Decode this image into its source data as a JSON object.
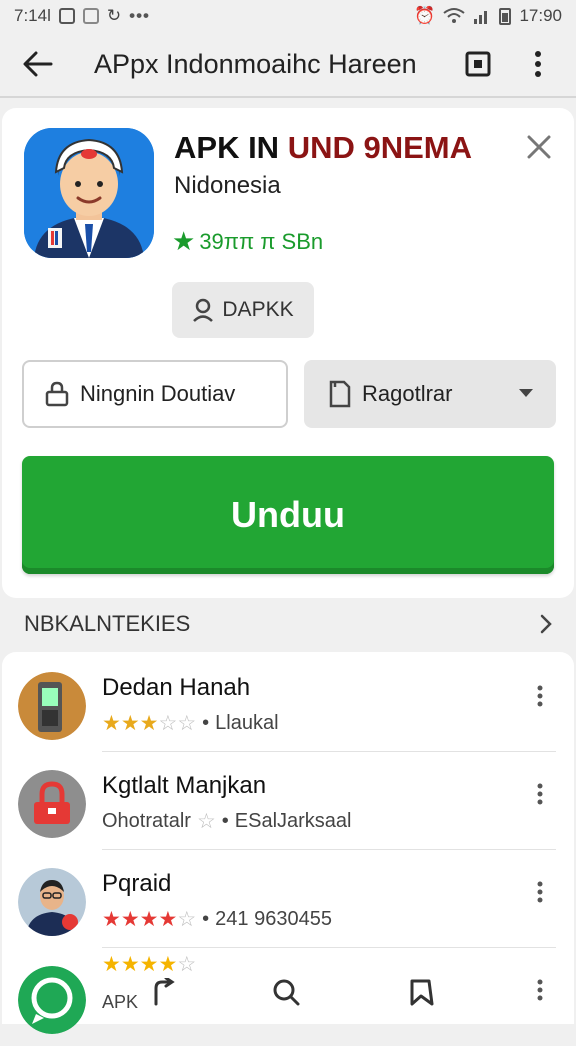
{
  "status_bar": {
    "time": "7:14l",
    "battery_time": "17:90",
    "dots": "•••"
  },
  "app_bar": {
    "title": "APpx Indonmoaihc Hareen"
  },
  "app": {
    "name_part1": "APK IN ",
    "name_part2": "UND 9NEMA",
    "developer": "Nidonesia",
    "rating_text": "39ππ π SBn",
    "chip_label": "DAPKK"
  },
  "buttons": {
    "outline_label": "Ningnin Doutiav",
    "select_label": "Ragotlrar",
    "primary_label": "Unduu"
  },
  "section": {
    "title": "NBKALNTEKIES"
  },
  "list": [
    {
      "name": "Dedan Hanah",
      "sub": "Llaukal",
      "stars": 5,
      "filled": 3,
      "star_color": "#e8a91c"
    },
    {
      "name": "Kgtlalt Manjkan",
      "sub_prefix": "Ohotratalr",
      "sub": "ESalJarksaal",
      "stars": 1,
      "filled": 0,
      "star_color": "#999999"
    },
    {
      "name": "Pqraid",
      "sub": "241 9630455",
      "stars": 5,
      "filled": 4,
      "star_color": "#e53935"
    },
    {
      "name": "",
      "sub": "APK",
      "stars": 5,
      "filled": 4,
      "star_color": "#f5b400"
    }
  ],
  "colors": {
    "accent_green": "#22a634",
    "title_red": "#8b1414"
  }
}
